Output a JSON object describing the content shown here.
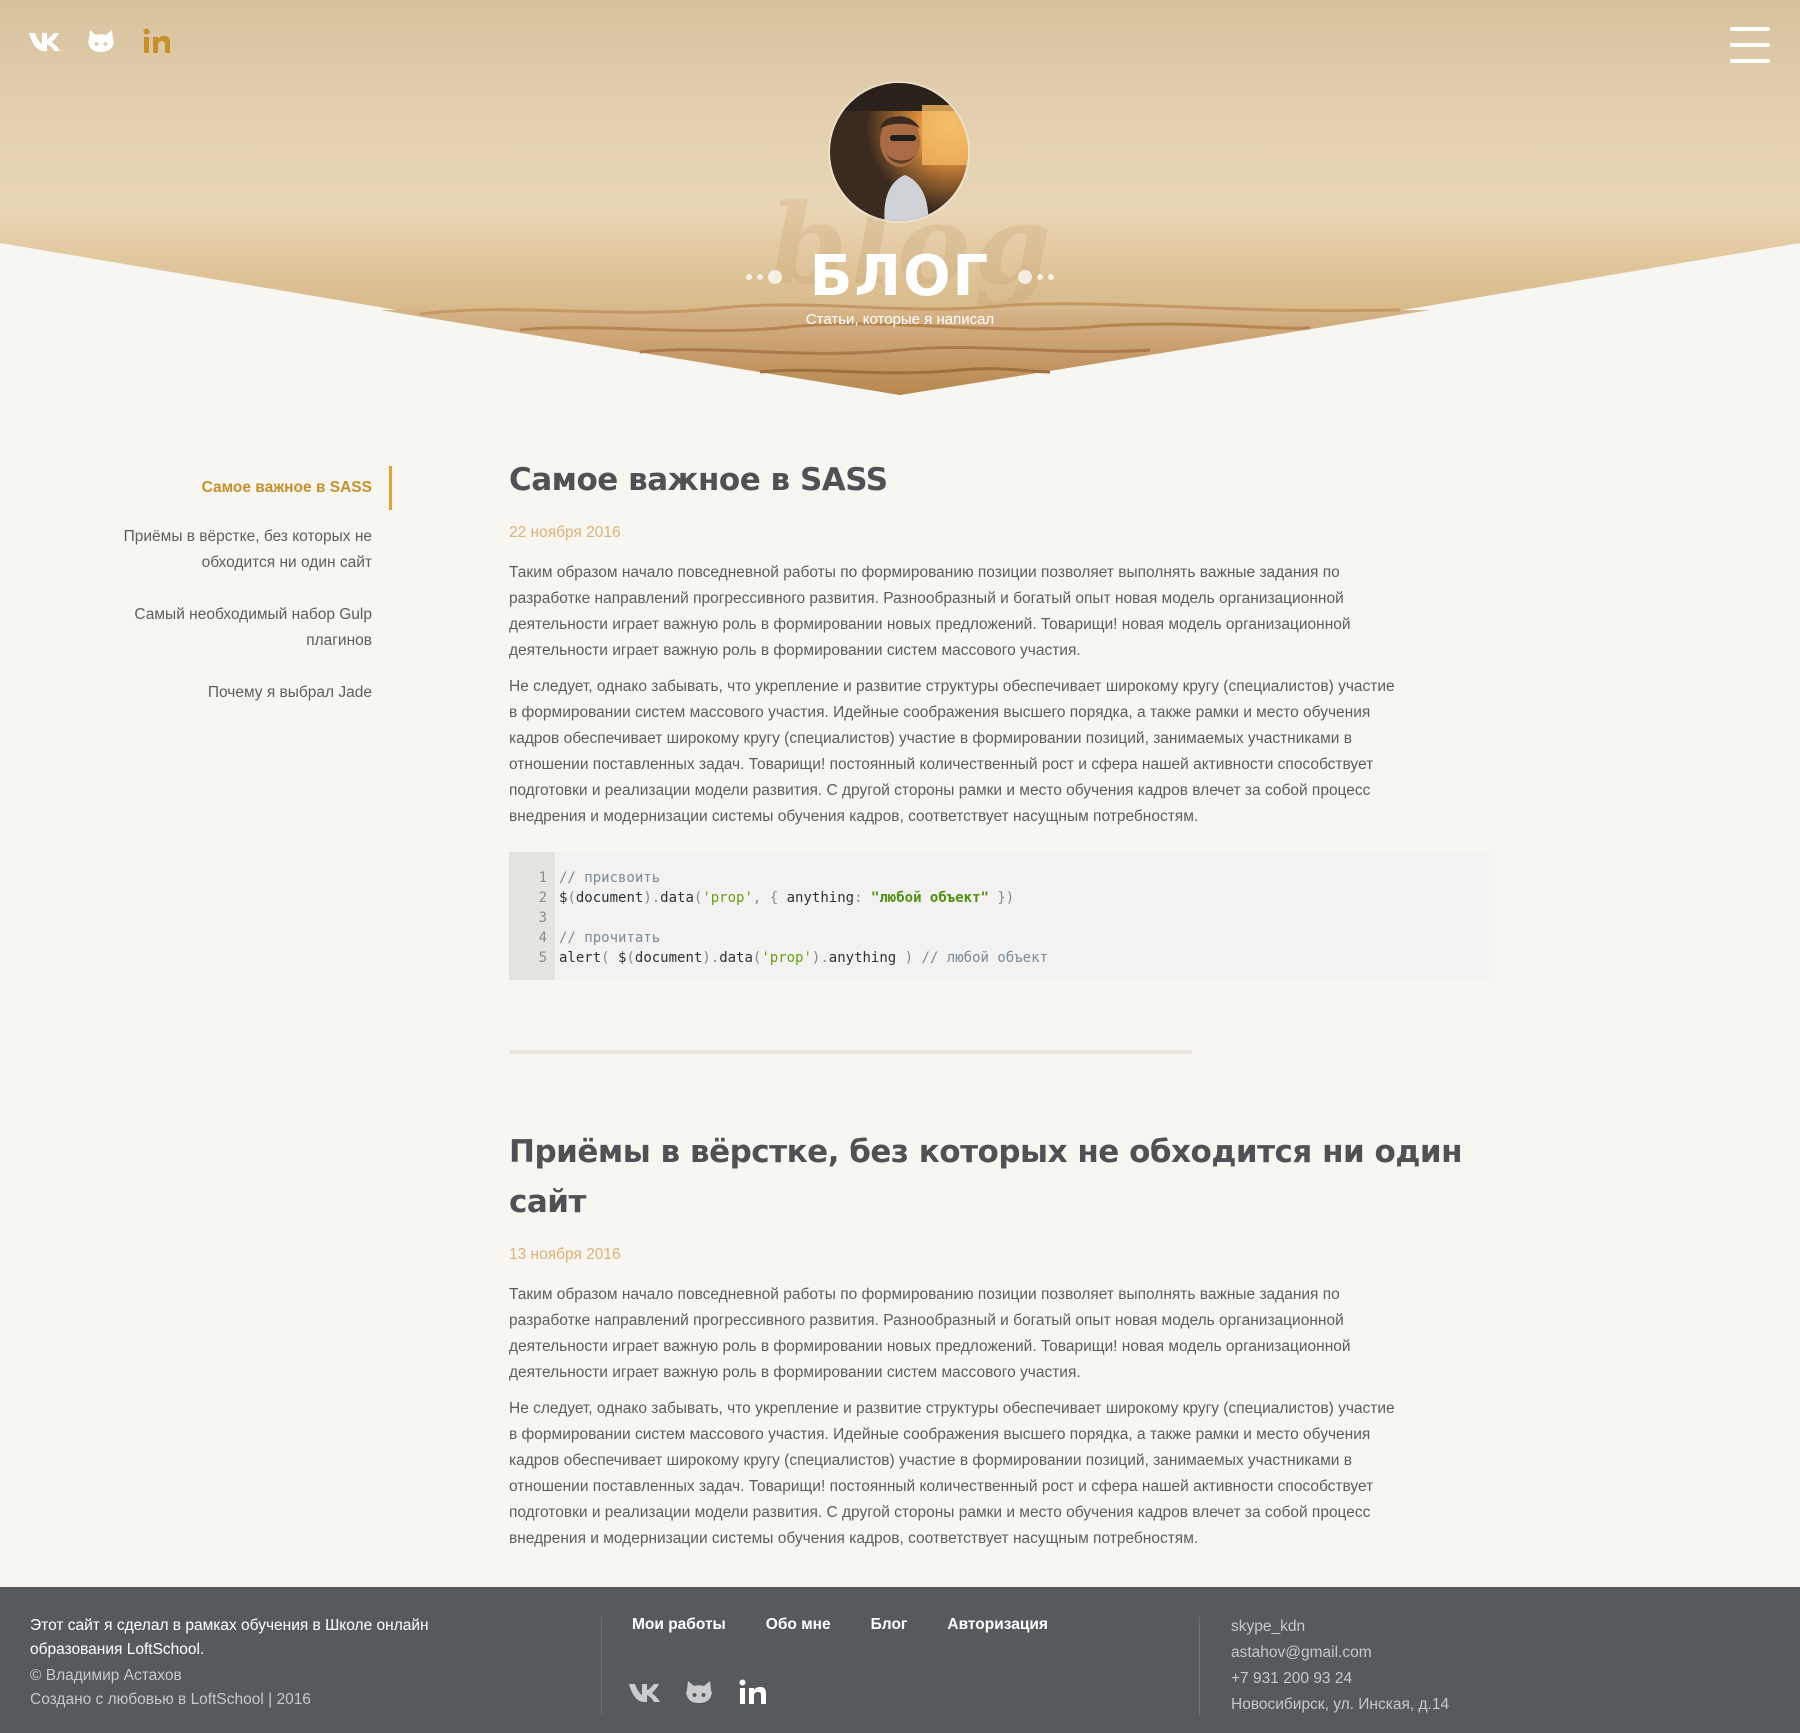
{
  "header": {
    "social": [
      {
        "name": "vk-icon"
      },
      {
        "name": "github-icon"
      },
      {
        "name": "linkedin-icon"
      }
    ],
    "title": "БЛОГ",
    "subtitle": "Статьи, которые я написал",
    "colors": {
      "accent": "#e0a33a",
      "accent_text": "#c7902c",
      "date": "#dab27a",
      "footer_bg": "#575a5c"
    }
  },
  "sidebar": {
    "items": [
      {
        "label": "Самое важное в SASS",
        "active": true
      },
      {
        "label": "Приёмы в вёрстке, без которых не обходится ни один сайт",
        "active": false
      },
      {
        "label": "Самый необходимый набор Gulp плагинов",
        "active": false
      },
      {
        "label": "Почему я выбрал Jade",
        "active": false
      }
    ]
  },
  "posts": [
    {
      "title": "Самое важное в SASS",
      "date": "22 ноября 2016",
      "paragraphs": [
        "Таким образом начало повседневной работы по формированию позиции позволяет выполнять важные задания по разработке направлений прогрессивного развития. Разнообразный и богатый опыт новая модель организационной деятельности играет важную роль в формировании новых предложений. Товарищи! новая модель организационной деятельности играет важную роль в формировании систем массового участия.",
        "Не следует, однако забывать, что укрепление и развитие структуры обеспечивает широкому кругу (специалистов) участие в формировании систем массового участия. Идейные соображения высшего порядка, а также рамки и место обучения кадров обеспечивает широкому кругу (специалистов) участие в формировании позиций, занимаемых участниками в отношении поставленных задач. Товарищи! постоянный количественный рост и сфера нашей активности способствует подготовки и реализации модели развития. С другой стороны рамки и место обучения кадров влечет за собой процесс внедрения и модернизации системы обучения кадров, соответствует насущным потребностям."
      ],
      "code": {
        "line_numbers": [
          "1",
          "2",
          "3",
          "4",
          "5"
        ],
        "l1": "// присвоить",
        "l2a": "$",
        "l2b": "(",
        "l2c": "document",
        "l2d": ").",
        "l2e": "data",
        "l2f": "(",
        "l2g": "'prop'",
        "l2h": ", { ",
        "l2i": "anything",
        "l2j": ": ",
        "l2k": "\"любой объект\"",
        "l2l": " })",
        "l4": "// прочитать",
        "l5a": "alert",
        "l5b": "( ",
        "l5c": "$",
        "l5d": "(",
        "l5e": "document",
        "l5f": ").",
        "l5g": "data",
        "l5h": "(",
        "l5i": "'prop'",
        "l5j": ").",
        "l5k": "anything",
        "l5l": " ) ",
        "l5m": "// любой объект"
      }
    },
    {
      "title": "Приёмы в вёрстке, без которых не обходится ни один сайт",
      "date": "13 ноября 2016",
      "paragraphs": [
        "Таким образом начало повседневной работы по формированию позиции позволяет выполнять важные задания по разработке направлений прогрессивного развития. Разнообразный и богатый опыт новая модель организационной деятельности играет важную роль в формировании новых предложений. Товарищи! новая модель организационной деятельности играет важную роль в формировании систем массового участия.",
        "Не следует, однако забывать, что укрепление и развитие структуры обеспечивает широкому кругу (специалистов) участие в формировании систем массового участия. Идейные соображения высшего порядка, а также рамки и место обучения кадров обеспечивает широкому кругу (специалистов) участие в формировании позиций, занимаемых участниками в отношении поставленных задач. Товарищи! постоянный количественный рост и сфера нашей активности способствует подготовки и реализации модели развития. С другой стороны рамки и место обучения кадров влечет за собой процесс внедрения и модернизации системы обучения кадров, соответствует насущным потребностям."
      ]
    }
  ],
  "footer": {
    "about_line1": "Этот сайт я сделал в рамках обучения в Школе онлайн образования LoftSchool.",
    "copyright": "© Владимир Астахов",
    "made_with": "Создано с любовью в LoftSchool | 2016",
    "nav": [
      "Мои работы",
      "Обо мне",
      "Блог",
      "Авторизация"
    ],
    "contacts": [
      "skype_kdn",
      "astahov@gmail.com",
      "+7 931 200 93 24",
      "Новосибирск, ул. Инская, д.14"
    ]
  }
}
